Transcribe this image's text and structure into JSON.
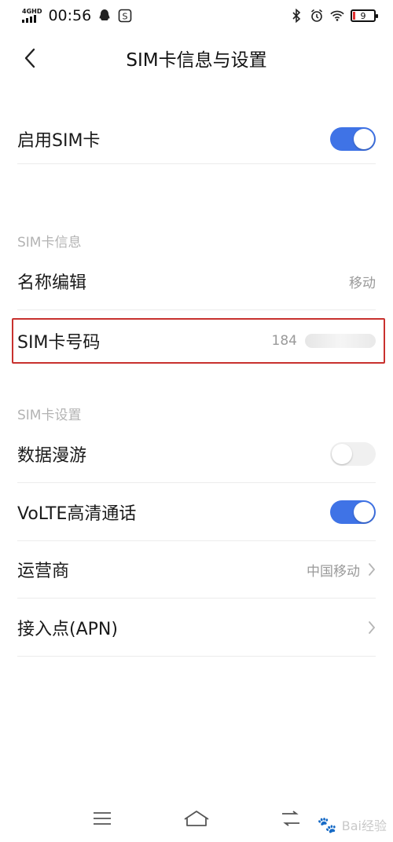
{
  "status_bar": {
    "network": "4GHD",
    "time": "00:56",
    "battery": "9"
  },
  "header": {
    "title": "SIM卡信息与设置"
  },
  "enable_sim": {
    "label": "启用SIM卡",
    "enabled": true
  },
  "sim_info": {
    "section_title": "SIM卡信息",
    "name_edit": {
      "label": "名称编辑",
      "value": "移动"
    },
    "sim_number": {
      "label": "SIM卡号码",
      "value": "184"
    }
  },
  "sim_settings": {
    "section_title": "SIM卡设置",
    "data_roaming": {
      "label": "数据漫游",
      "enabled": false
    },
    "volte": {
      "label": "VoLTE高清通话",
      "enabled": true
    },
    "carrier": {
      "label": "运营商",
      "value": "中国移动"
    },
    "apn": {
      "label": "接入点(APN)"
    }
  },
  "watermark": {
    "text": "Bai经验"
  },
  "colors": {
    "accent": "#3f73e6",
    "highlight": "#c8312e"
  }
}
